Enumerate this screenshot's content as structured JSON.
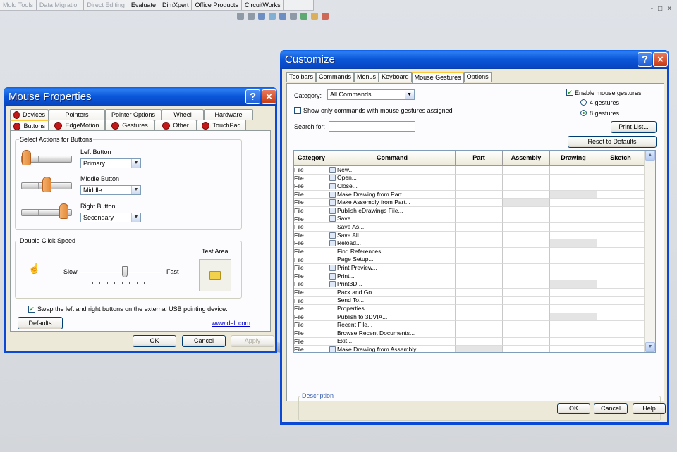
{
  "toolbar": {
    "tabs": [
      {
        "label": "Mold Tools",
        "dim": true
      },
      {
        "label": "Data Migration",
        "dim": true
      },
      {
        "label": "Direct Editing",
        "dim": true
      },
      {
        "label": "Evaluate",
        "dim": false
      },
      {
        "label": "DimXpert",
        "dim": false
      },
      {
        "label": "Office Products",
        "dim": false
      },
      {
        "label": "CircuitWorks",
        "dim": false
      }
    ],
    "window_controls": [
      "-",
      "□",
      "×"
    ]
  },
  "mouse_dialog": {
    "title": "Mouse Properties",
    "help_glyph": "?",
    "close_glyph": "×",
    "tabs_row1": [
      "Devices",
      "Pointers",
      "Pointer Options",
      "Wheel",
      "Hardware"
    ],
    "tabs_row2": [
      "Buttons",
      "EdgeMotion",
      "Gestures",
      "Other",
      "TouchPad"
    ],
    "active_tab": "Buttons",
    "select_actions_label": "Select Actions for Buttons",
    "left_button_label": "Left Button",
    "left_button_value": "Primary",
    "middle_button_label": "Middle Button",
    "middle_button_value": "Middle",
    "right_button_label": "Right Button",
    "right_button_value": "Secondary",
    "double_click_label": "Double Click Speed",
    "slow_label": "Slow",
    "fast_label": "Fast",
    "double_click_speed": 0.55,
    "test_area_label": "Test Area",
    "swap_label": "Swap the left and right buttons on the external USB pointing device.",
    "swap_checked": true,
    "defaults_label": "Defaults",
    "link_text": "www.dell.com",
    "ok_label": "OK",
    "cancel_label": "Cancel",
    "apply_label": "Apply"
  },
  "customize_dialog": {
    "title": "Customize",
    "tabs": [
      "Toolbars",
      "Commands",
      "Menus",
      "Keyboard",
      "Mouse Gestures",
      "Options"
    ],
    "active_tab": "Mouse Gestures",
    "category_label": "Category:",
    "category_value": "All Commands",
    "show_only_label": "Show only commands with mouse gestures assigned",
    "show_only_checked": false,
    "search_label": "Search for:",
    "search_value": "",
    "enable_label": "Enable mouse gestures",
    "enable_checked": true,
    "gesture_options": [
      "4 gestures",
      "8 gestures"
    ],
    "gesture_selected": "8 gestures",
    "print_list_label": "Print List...",
    "reset_label": "Reset to Defaults",
    "columns": [
      "Category",
      "Command",
      "Part",
      "Assembly",
      "Drawing",
      "Sketch"
    ],
    "rows": [
      {
        "category": "File",
        "command": "New...",
        "icon": "new-doc-icon",
        "shade": []
      },
      {
        "category": "File",
        "command": "Open...",
        "icon": "open-folder-icon",
        "shade": []
      },
      {
        "category": "File",
        "command": "Close...",
        "icon": "close-doc-icon",
        "shade": []
      },
      {
        "category": "File",
        "command": "Make Drawing from Part...",
        "icon": "drawing-icon",
        "shade": [
          "Drawing"
        ]
      },
      {
        "category": "File",
        "command": "Make Assembly from Part...",
        "icon": "assembly-icon",
        "shade": [
          "Assembly"
        ]
      },
      {
        "category": "File",
        "command": "Publish eDrawings File...",
        "icon": "edrawings-icon",
        "shade": []
      },
      {
        "category": "File",
        "command": "Save...",
        "icon": "save-icon",
        "shade": []
      },
      {
        "category": "File",
        "command": "Save As...",
        "icon": "",
        "shade": []
      },
      {
        "category": "File",
        "command": "Save All...",
        "icon": "save-all-icon",
        "shade": []
      },
      {
        "category": "File",
        "command": "Reload...",
        "icon": "reload-icon",
        "shade": [
          "Drawing"
        ]
      },
      {
        "category": "File",
        "command": "Find References...",
        "icon": "",
        "shade": []
      },
      {
        "category": "File",
        "command": "Page Setup...",
        "icon": "",
        "shade": []
      },
      {
        "category": "File",
        "command": "Print Preview...",
        "icon": "print-preview-icon",
        "shade": []
      },
      {
        "category": "File",
        "command": "Print...",
        "icon": "print-icon",
        "shade": []
      },
      {
        "category": "File",
        "command": "Print3D...",
        "icon": "print3d-icon",
        "shade": [
          "Drawing"
        ]
      },
      {
        "category": "File",
        "command": "Pack and Go...",
        "icon": "",
        "shade": []
      },
      {
        "category": "File",
        "command": "Send To...",
        "icon": "",
        "shade": []
      },
      {
        "category": "File",
        "command": "Properties...",
        "icon": "",
        "shade": []
      },
      {
        "category": "File",
        "command": "Publish to 3DVIA...",
        "icon": "",
        "shade": [
          "Drawing"
        ]
      },
      {
        "category": "File",
        "command": "Recent File...",
        "icon": "",
        "shade": []
      },
      {
        "category": "File",
        "command": "Browse Recent Documents...",
        "icon": "",
        "shade": []
      },
      {
        "category": "File",
        "command": "Exit...",
        "icon": "",
        "shade": []
      },
      {
        "category": "File",
        "command": "Make Drawing from Assembly...",
        "icon": "drawing-icon",
        "shade": [
          "Part"
        ]
      }
    ],
    "description_label": "Description",
    "ok_label": "OK",
    "cancel_label": "Cancel",
    "help_label": "Help",
    "help_glyph": "?",
    "close_glyph": "×"
  }
}
